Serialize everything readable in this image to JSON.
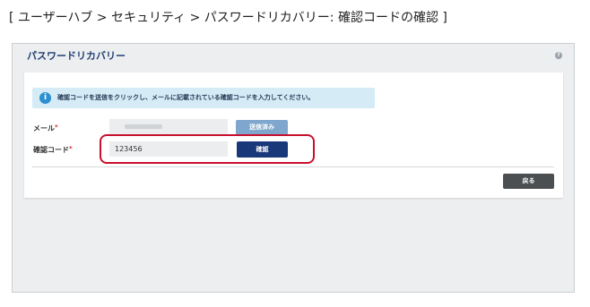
{
  "breadcrumb": "[ ユーザーハブ > セキュリティ > パスワードリカバリー: 確認コードの確認 ]",
  "card": {
    "title": "パスワードリカバリー",
    "help_glyph": "?"
  },
  "info": {
    "glyph": "i",
    "message": "確認コードを送信をクリックし、メールに記載されている確認コードを入力してください。"
  },
  "form": {
    "email_label": "メール",
    "email_required": "*",
    "sent_button": "送信済み",
    "code_label": "確認コード",
    "code_required": "*",
    "code_value": "123456",
    "confirm_button": "確認"
  },
  "footer": {
    "back_button": "戻る"
  },
  "colors": {
    "title": "#1f3f73",
    "info_bg": "#d5ebf6",
    "confirm_button": "#19387a",
    "sent_button": "#7fa6cc",
    "back_button": "#4c4f52",
    "highlight": "#c8102e"
  },
  "icons": {
    "help": "help-circle-icon",
    "info": "info-circle-icon"
  }
}
